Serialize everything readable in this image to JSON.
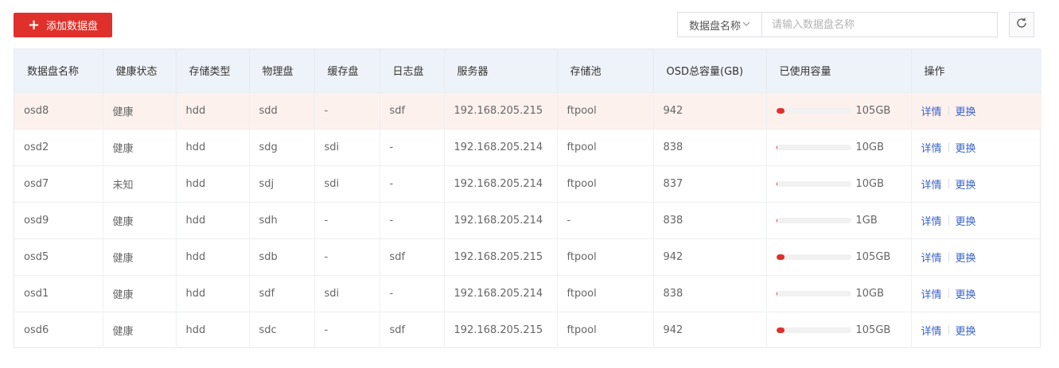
{
  "toolbar": {
    "add_label": "添加数据盘",
    "search_field": "数据盘名称",
    "search_placeholder": "请输入数据盘名称"
  },
  "table": {
    "headers": [
      "数据盘名称",
      "健康状态",
      "存储类型",
      "物理盘",
      "缓存盘",
      "日志盘",
      "服务器",
      "存储池",
      "OSD总容量(GB)",
      "已使用容量",
      "操作"
    ],
    "rows": [
      {
        "name": "osd8",
        "health": "健康",
        "type": "hdd",
        "physical": "sdd",
        "cache": "-",
        "log": "sdf",
        "server": "192.168.205.215",
        "pool": "ftpool",
        "capacity": "942",
        "used": "105GB",
        "used_ratio": 0.111,
        "detail": "详情",
        "replace": "更换"
      },
      {
        "name": "osd2",
        "health": "健康",
        "type": "hdd",
        "physical": "sdg",
        "cache": "sdi",
        "log": "-",
        "server": "192.168.205.214",
        "pool": "ftpool",
        "capacity": "838",
        "used": "10GB",
        "used_ratio": 0.012,
        "detail": "详情",
        "replace": "更换"
      },
      {
        "name": "osd7",
        "health": "未知",
        "type": "hdd",
        "physical": "sdj",
        "cache": "sdi",
        "log": "-",
        "server": "192.168.205.214",
        "pool": "ftpool",
        "capacity": "837",
        "used": "10GB",
        "used_ratio": 0.012,
        "detail": "详情",
        "replace": "更换"
      },
      {
        "name": "osd9",
        "health": "健康",
        "type": "hdd",
        "physical": "sdh",
        "cache": "-",
        "log": "-",
        "server": "192.168.205.214",
        "pool": "-",
        "capacity": "838",
        "used": "1GB",
        "used_ratio": 0.0012,
        "detail": "详情",
        "replace": "更换"
      },
      {
        "name": "osd5",
        "health": "健康",
        "type": "hdd",
        "physical": "sdb",
        "cache": "-",
        "log": "sdf",
        "server": "192.168.205.215",
        "pool": "ftpool",
        "capacity": "942",
        "used": "105GB",
        "used_ratio": 0.111,
        "detail": "详情",
        "replace": "更换"
      },
      {
        "name": "osd1",
        "health": "健康",
        "type": "hdd",
        "physical": "sdf",
        "cache": "sdi",
        "log": "-",
        "server": "192.168.205.214",
        "pool": "ftpool",
        "capacity": "838",
        "used": "10GB",
        "used_ratio": 0.012,
        "detail": "详情",
        "replace": "更换"
      },
      {
        "name": "osd6",
        "health": "健康",
        "type": "hdd",
        "physical": "sdc",
        "cache": "-",
        "log": "sdf",
        "server": "192.168.205.215",
        "pool": "ftpool",
        "capacity": "942",
        "used": "105GB",
        "used_ratio": 0.111,
        "detail": "详情",
        "replace": "更换"
      }
    ]
  },
  "colors": {
    "accent": "#e0302b",
    "link": "#3a63c8",
    "highlight_row": "#fdf1ee",
    "header_bg": "#eef3f9"
  },
  "icons": {
    "add": "plus-icon",
    "dropdown": "chevron-down-icon",
    "refresh": "refresh-icon"
  }
}
